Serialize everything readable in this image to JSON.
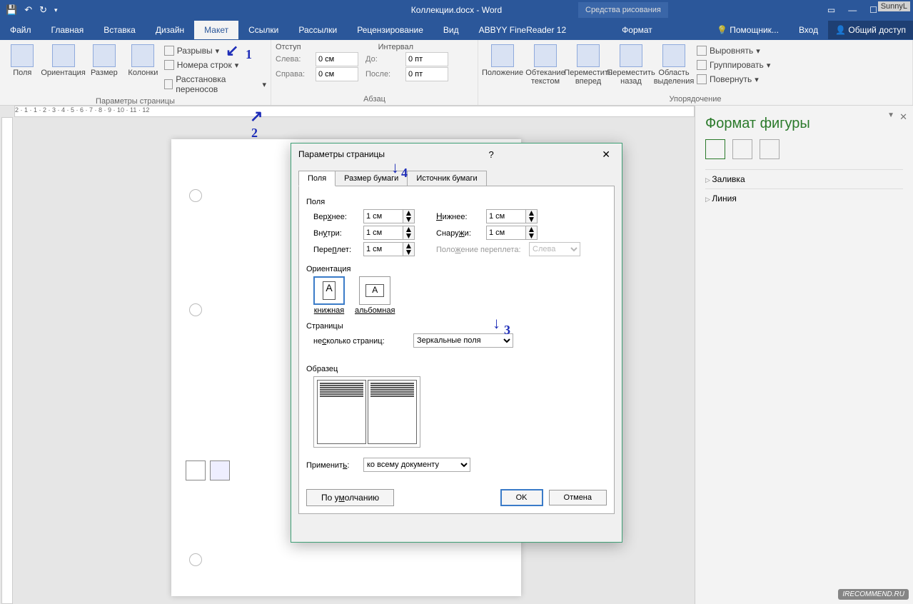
{
  "titlebar": {
    "doc_title": "Коллекции.docx - Word",
    "tools_tab": "Средства рисования",
    "user_badge": "SunnyL"
  },
  "menu": {
    "tabs": [
      "Файл",
      "Главная",
      "Вставка",
      "Дизайн",
      "Макет",
      "Ссылки",
      "Рассылки",
      "Рецензирование",
      "Вид",
      "ABBYY FineReader 12",
      "Формат"
    ],
    "active": 4,
    "tell_me": "Помощник...",
    "login": "Вход",
    "share": "Общий доступ"
  },
  "ribbon": {
    "page_setup": {
      "margins": "Поля",
      "orientation": "Ориентация",
      "size": "Размер",
      "columns": "Колонки",
      "breaks": "Разрывы",
      "line_numbers": "Номера строк",
      "hyphenation": "Расстановка переносов",
      "group": "Параметры страницы"
    },
    "paragraph": {
      "indent_label": "Отступ",
      "spacing_label": "Интервал",
      "left": "Слева:",
      "right": "Справа:",
      "before": "До:",
      "after": "После:",
      "left_val": "0 см",
      "right_val": "0 см",
      "before_val": "0 пт",
      "after_val": "0 пт",
      "group": "Абзац"
    },
    "arrange": {
      "position": "Положение",
      "wrap": "Обтекание текстом",
      "forward": "Переместить вперед",
      "backward": "Переместить назад",
      "selection": "Область выделения",
      "align": "Выровнять",
      "group_btn": "Группировать",
      "rotate": "Повернуть",
      "group": "Упорядочение"
    }
  },
  "dialog": {
    "title": "Параметры страницы",
    "tabs": [
      "Поля",
      "Размер бумаги",
      "Источник бумаги"
    ],
    "margins_section": "Поля",
    "top": "Вер<u>х</u>нее:",
    "bottom": "<u>Н</u>ижнее:",
    "inside": "Вн<u>у</u>три:",
    "outside": "Снару<u>ж</u>и:",
    "gutter": "Пере<u>п</u>лет:",
    "gutter_pos": "Поло<u>ж</u>ение переплета:",
    "val_1cm": "1 см",
    "gutter_pos_val": "Слева",
    "orientation_section": "Ориентация",
    "portrait": "книжная",
    "landscape": "альбомная",
    "pages_section": "Страницы",
    "multi_pages": "не<u>с</u>колько страниц:",
    "multi_val": "Зеркальные поля",
    "preview_section": "Образец",
    "apply_to": "Применит<u>ь</u>:",
    "apply_val": "ко всему документу",
    "default_btn": "По умолчанию",
    "ok": "OK",
    "cancel": "Отмена"
  },
  "sidepanel": {
    "title": "Формат фигуры",
    "fill": "Заливка",
    "line": "Линия"
  },
  "annotations": {
    "a1": "1",
    "a2": "2",
    "a3": "3",
    "a4": "4"
  },
  "watermark": "IRECOMMEND.RU"
}
